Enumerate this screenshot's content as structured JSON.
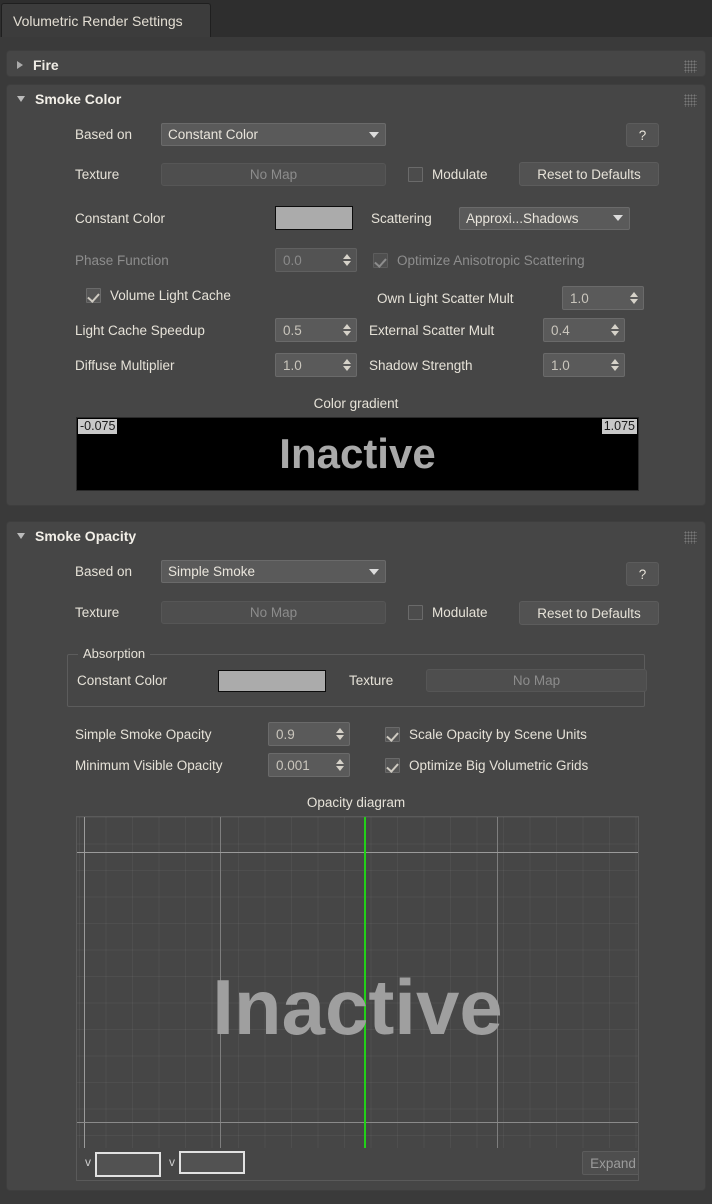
{
  "window": {
    "tab_label": "Volumetric Render Settings"
  },
  "rollouts": {
    "fire": {
      "title": "Fire",
      "state": "collapsed"
    },
    "smoke_color": {
      "title": "Smoke Color",
      "state": "expanded"
    },
    "smoke_opacity": {
      "title": "Smoke Opacity",
      "state": "expanded"
    }
  },
  "smoke_color": {
    "based_on_label": "Based on",
    "based_on_value": "Constant Color",
    "help_label": "?",
    "texture_label": "Texture",
    "texture_value": "No Map",
    "modulate_label": "Modulate",
    "modulate_checked": false,
    "reset_label": "Reset to Defaults",
    "constant_color_label": "Constant Color",
    "constant_color_value": "#ababab",
    "scattering_label": "Scattering",
    "scattering_value": "Approxi...Shadows",
    "phase_function_label": "Phase Function",
    "phase_function_value": "0.0",
    "optimize_aniso_label": "Optimize Anisotropic Scattering",
    "optimize_aniso_checked": true,
    "volume_light_cache_label": "Volume Light Cache",
    "volume_light_cache_checked": true,
    "own_light_scatter_label": "Own Light Scatter Mult",
    "own_light_scatter_value": "1.0",
    "light_cache_speedup_label": "Light Cache Speedup",
    "light_cache_speedup_value": "0.5",
    "external_scatter_label": "External Scatter Mult",
    "external_scatter_value": "0.4",
    "diffuse_multiplier_label": "Diffuse Multiplier",
    "diffuse_multiplier_value": "1.0",
    "shadow_strength_label": "Shadow Strength",
    "shadow_strength_value": "1.0",
    "gradient_title": "Color gradient",
    "gradient_min": "-0.075",
    "gradient_max": "1.075",
    "gradient_overlay": "Inactive"
  },
  "smoke_opacity": {
    "based_on_label": "Based on",
    "based_on_value": "Simple Smoke",
    "help_label": "?",
    "texture_label": "Texture",
    "texture_value": "No Map",
    "modulate_label": "Modulate",
    "modulate_checked": false,
    "reset_label": "Reset to Defaults",
    "absorption_title": "Absorption",
    "absorption_constant_color_label": "Constant Color",
    "absorption_constant_color_value": "#ababab",
    "absorption_texture_label": "Texture",
    "absorption_texture_value": "No Map",
    "simple_smoke_opacity_label": "Simple Smoke Opacity",
    "simple_smoke_opacity_value": "0.9",
    "minimum_visible_opacity_label": "Minimum Visible Opacity",
    "minimum_visible_opacity_value": "0.001",
    "scale_opacity_label": "Scale Opacity by Scene Units",
    "scale_opacity_checked": true,
    "optimize_big_grids_label": "Optimize Big Volumetric Grids",
    "optimize_big_grids_checked": true,
    "diagram_title": "Opacity diagram",
    "diagram_overlay": "Inactive",
    "diagram_field_1": "",
    "diagram_field_2": "",
    "diagram_chevron_1": "v",
    "diagram_chevron_2": "v",
    "expand_label": "Expand",
    "marker_color": "#22d018",
    "threshold_color": "#ee1c1c"
  }
}
